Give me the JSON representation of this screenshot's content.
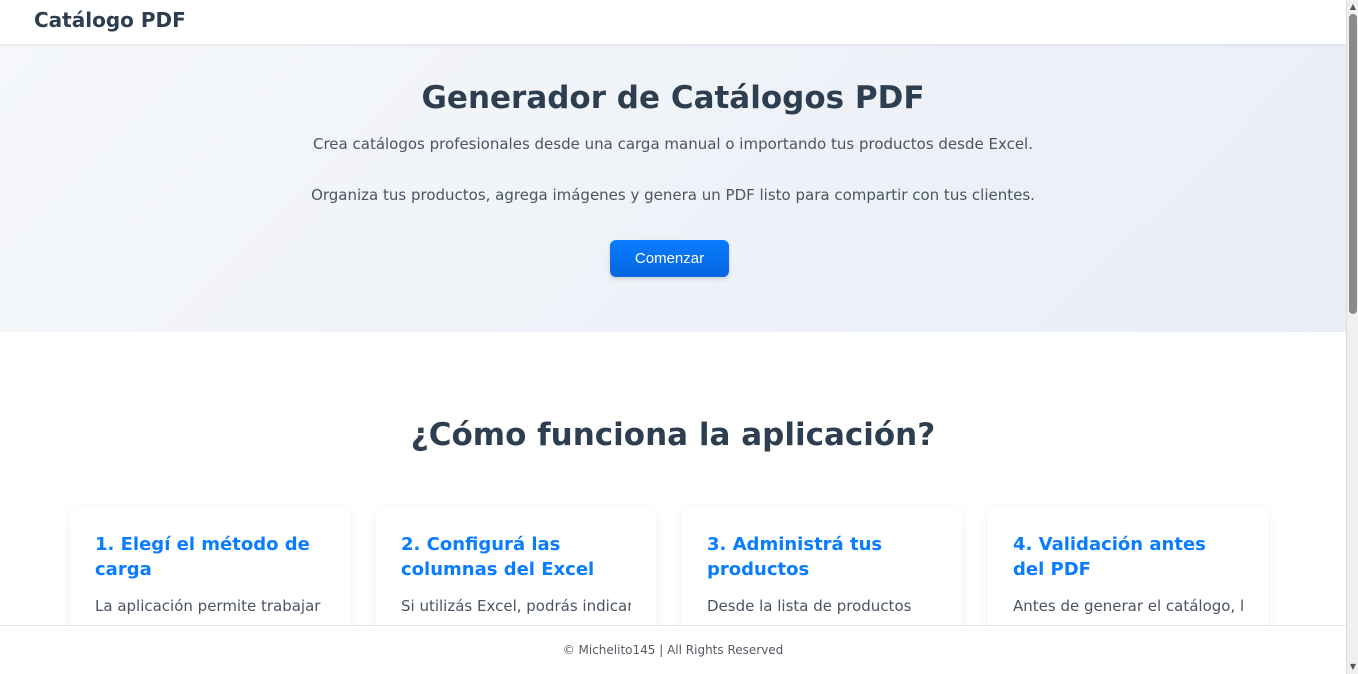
{
  "navbar": {
    "brand": "Catálogo PDF"
  },
  "hero": {
    "title": "Generador de Catálogos PDF",
    "paragraph1": "Crea catálogos profesionales desde una carga manual o importando tus productos desde Excel.",
    "paragraph2": "Organiza tus productos, agrega imágenes y genera un PDF listo para compartir con tus clientes.",
    "button_label": "Comenzar"
  },
  "how": {
    "title": "¿Cómo funciona la aplicación?",
    "cards": [
      {
        "title": "1. Elegí el método de carga",
        "text": "La aplicación permite trabajar de"
      },
      {
        "title": "2. Configurá las columnas del Excel",
        "text": "Si utilizás Excel, podrás indicar"
      },
      {
        "title": "3. Administrá tus productos",
        "text": "Desde la lista de productos"
      },
      {
        "title": "4. Validación antes del PDF",
        "text": "Antes de generar el catálogo, la"
      }
    ]
  },
  "footer": {
    "text": "© Michelito145 | All Rights Reserved"
  },
  "colors": {
    "accent": "#0a7cff",
    "heading": "#2c3e50",
    "body_text": "#4a5563"
  }
}
